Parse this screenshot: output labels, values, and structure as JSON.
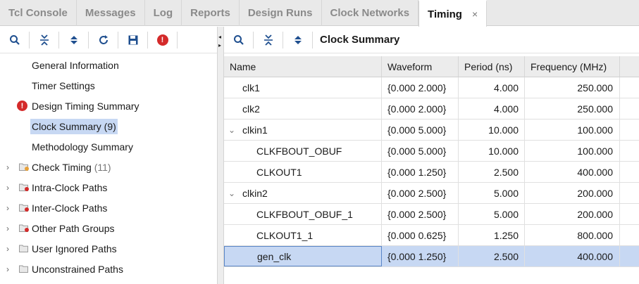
{
  "tabs": [
    {
      "label": "Tcl Console",
      "active": false
    },
    {
      "label": "Messages",
      "active": false
    },
    {
      "label": "Log",
      "active": false
    },
    {
      "label": "Reports",
      "active": false
    },
    {
      "label": "Design Runs",
      "active": false
    },
    {
      "label": "Clock Networks",
      "active": false
    },
    {
      "label": "Timing",
      "active": true,
      "close": "×"
    }
  ],
  "left_toolbar": {
    "icons": [
      "search-icon",
      "collapse-all-icon",
      "expand-all-icon",
      "refresh-icon",
      "save-icon",
      "error-icon"
    ],
    "error_glyph": "!"
  },
  "tree": [
    {
      "label": "General Information",
      "chevron": "",
      "icon": "",
      "count": ""
    },
    {
      "label": "Timer Settings",
      "chevron": "",
      "icon": "",
      "count": ""
    },
    {
      "label": "Design Timing Summary",
      "chevron": "",
      "icon": "error",
      "count": ""
    },
    {
      "label": "Clock Summary (9)",
      "chevron": "",
      "icon": "",
      "count": "",
      "selected": true
    },
    {
      "label": "Methodology Summary",
      "chevron": "",
      "icon": "",
      "count": ""
    },
    {
      "label": "Check Timing",
      "chevron": "›",
      "icon": "folder-warning",
      "count": "(11)"
    },
    {
      "label": "Intra-Clock Paths",
      "chevron": "›",
      "icon": "folder-error",
      "count": ""
    },
    {
      "label": "Inter-Clock Paths",
      "chevron": "›",
      "icon": "folder-error",
      "count": ""
    },
    {
      "label": "Other Path Groups",
      "chevron": "›",
      "icon": "folder-error",
      "count": ""
    },
    {
      "label": "User Ignored Paths",
      "chevron": "›",
      "icon": "folder",
      "count": ""
    },
    {
      "label": "Unconstrained Paths",
      "chevron": "›",
      "icon": "folder",
      "count": ""
    }
  ],
  "right_toolbar": {
    "icons": [
      "search-icon",
      "collapse-all-icon",
      "expand-all-icon"
    ],
    "title": "Clock Summary"
  },
  "table": {
    "columns": [
      "Name",
      "Waveform",
      "Period (ns)",
      "Frequency (MHz)"
    ],
    "rows": [
      {
        "name": "clk1",
        "level": 0,
        "expander": "",
        "waveform": "{0.000 2.000}",
        "period": "4.000",
        "frequency": "250.000"
      },
      {
        "name": "clk2",
        "level": 0,
        "expander": "",
        "waveform": "{0.000 2.000}",
        "period": "4.000",
        "frequency": "250.000"
      },
      {
        "name": "clkin1",
        "level": 0,
        "expander": "⌄",
        "waveform": "{0.000 5.000}",
        "period": "10.000",
        "frequency": "100.000"
      },
      {
        "name": "CLKFBOUT_OBUF",
        "level": 1,
        "expander": "",
        "waveform": "{0.000 5.000}",
        "period": "10.000",
        "frequency": "100.000"
      },
      {
        "name": "CLKOUT1",
        "level": 1,
        "expander": "",
        "waveform": "{0.000 1.250}",
        "period": "2.500",
        "frequency": "400.000"
      },
      {
        "name": "clkin2",
        "level": 0,
        "expander": "⌄",
        "waveform": "{0.000 2.500}",
        "period": "5.000",
        "frequency": "200.000"
      },
      {
        "name": "CLKFBOUT_OBUF_1",
        "level": 1,
        "expander": "",
        "waveform": "{0.000 2.500}",
        "period": "5.000",
        "frequency": "200.000"
      },
      {
        "name": "CLKOUT1_1",
        "level": 1,
        "expander": "",
        "waveform": "{0.000 0.625}",
        "period": "1.250",
        "frequency": "800.000"
      },
      {
        "name": "gen_clk",
        "level": 1,
        "expander": "",
        "waveform": "{0.000 1.250}",
        "period": "2.500",
        "frequency": "400.000",
        "selected": true
      }
    ]
  },
  "colors": {
    "accent": "#c7d8f3",
    "error": "#d42a2a",
    "icon_blue": "#1f4f8f"
  }
}
